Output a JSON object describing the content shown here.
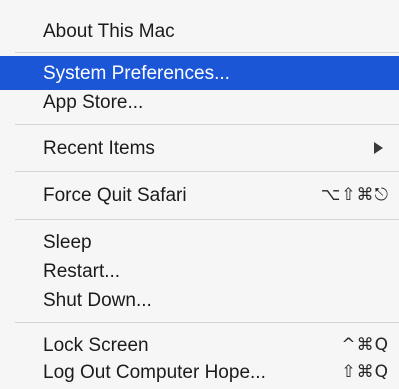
{
  "menu": {
    "about": "About This Mac",
    "system_preferences": "System Preferences...",
    "app_store": "App Store...",
    "recent_items": "Recent Items",
    "force_quit": "Force Quit Safari",
    "force_quit_shortcut": "⌥⇧⌘⎋",
    "sleep": "Sleep",
    "restart": "Restart...",
    "shut_down": "Shut Down...",
    "lock_screen": "Lock Screen",
    "lock_screen_shortcut": "^⌘Q",
    "log_out": "Log Out Computer Hope...",
    "log_out_shortcut": "⇧⌘Q"
  },
  "icons": {
    "submenu": "submenu-arrow-icon"
  },
  "colors": {
    "highlight": "#1a56d6",
    "menu_background": "#f6f6f6",
    "separator": "#d4d4d4"
  }
}
